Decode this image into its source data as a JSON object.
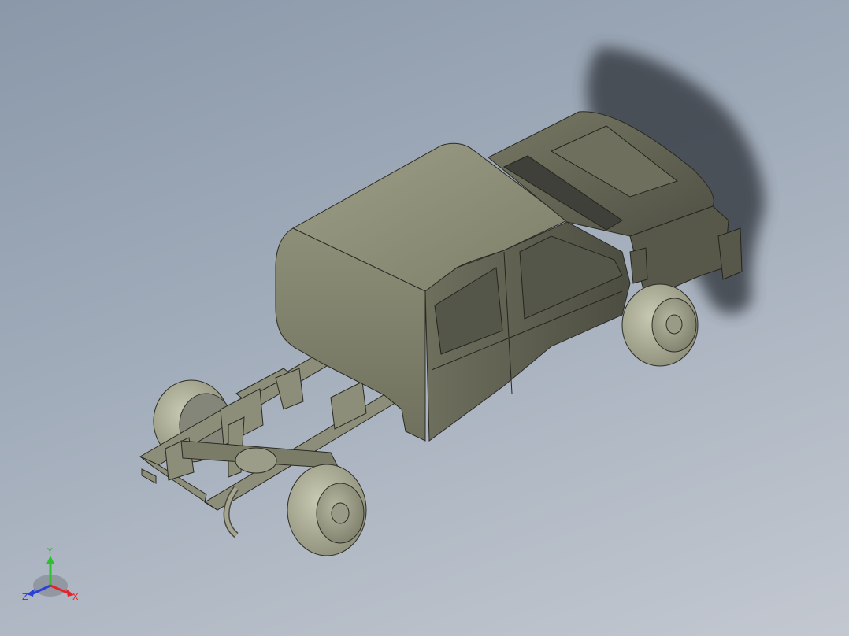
{
  "viewport": {
    "background_top": "#8a98a9",
    "background_bottom": "#c3c8d0"
  },
  "model": {
    "body_color": "#8b8c76",
    "dark_color": "#4a4b40",
    "shadow_color": "#3b3f46"
  },
  "triad": {
    "x_label": "X",
    "y_label": "Y",
    "z_label": "Z",
    "x_color": "#e0262b",
    "y_color": "#2fbf2f",
    "z_color": "#2b3fd9"
  }
}
